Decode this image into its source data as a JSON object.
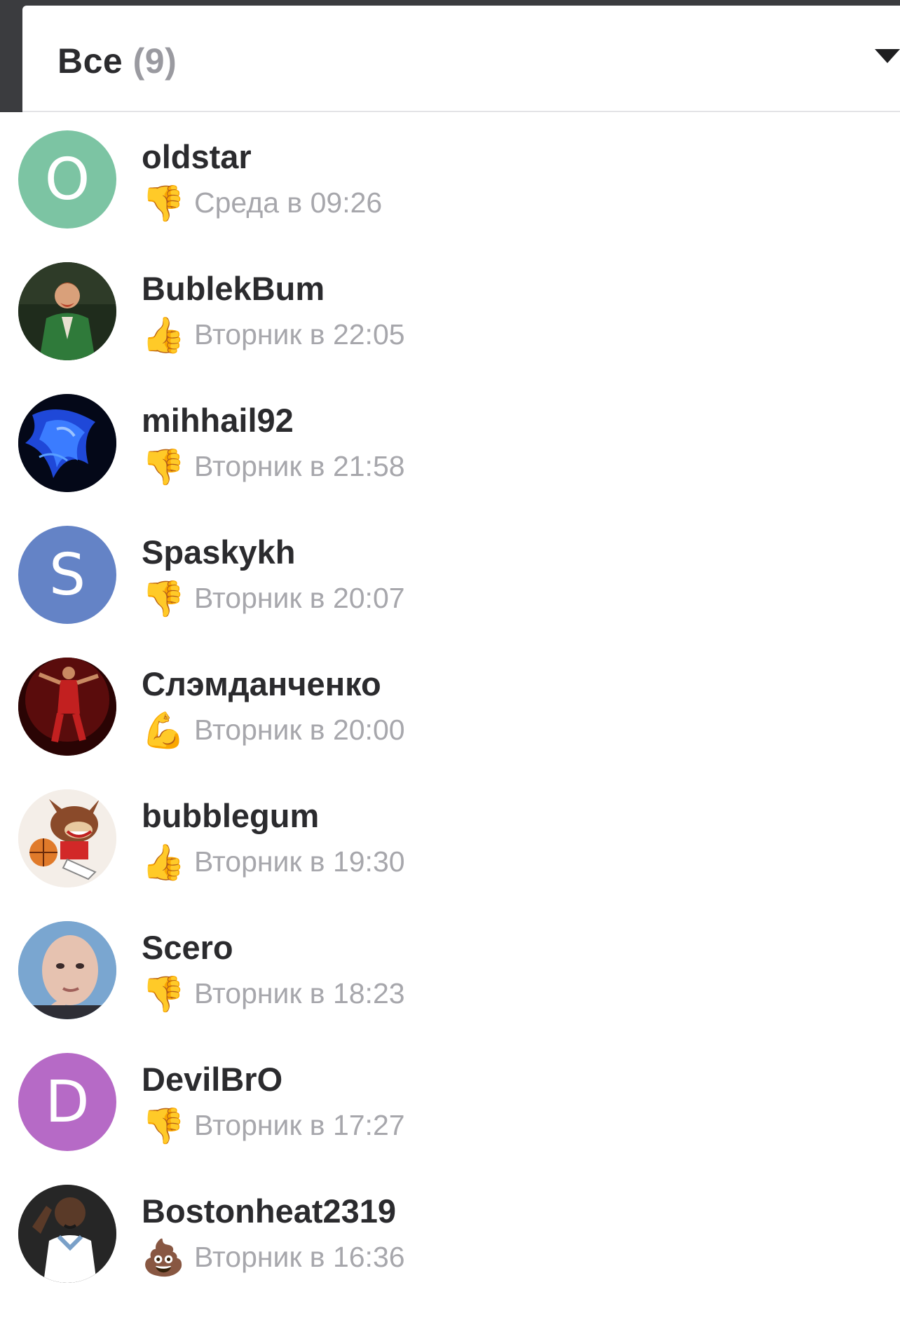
{
  "header": {
    "title": "Все",
    "count": "(9)"
  },
  "users": [
    {
      "name": "oldstar",
      "time": "Среда в 09:26",
      "reaction": "👎",
      "reaction_icon": "thumbs-down-icon",
      "avatar_letter": "O",
      "avatar_color": "#7cc4a3"
    },
    {
      "name": "BublekBum",
      "time": "Вторник в 22:05",
      "reaction": "👍",
      "reaction_icon": "thumbs-up-icon",
      "avatar_letter": "",
      "avatar_color": "#2f4a2a"
    },
    {
      "name": "mihhail92",
      "time": "Вторник в 21:58",
      "reaction": "👎",
      "reaction_icon": "thumbs-down-icon",
      "avatar_letter": "",
      "avatar_color": "#0a1a5a"
    },
    {
      "name": "Spaskykh",
      "time": "Вторник в 20:07",
      "reaction": "👎",
      "reaction_icon": "thumbs-down-icon",
      "avatar_letter": "S",
      "avatar_color": "#6483c6"
    },
    {
      "name": "Слэмданченко",
      "time": "Вторник в 20:00",
      "reaction": "💪",
      "reaction_icon": "flexed-biceps-icon",
      "avatar_letter": "",
      "avatar_color": "#4a0a0a"
    },
    {
      "name": "bubblegum",
      "time": "Вторник в 19:30",
      "reaction": "👍",
      "reaction_icon": "thumbs-up-icon",
      "avatar_letter": "",
      "avatar_color": "#f2ece6"
    },
    {
      "name": "Scero",
      "time": "Вторник в 18:23",
      "reaction": "👎",
      "reaction_icon": "thumbs-down-icon",
      "avatar_letter": "",
      "avatar_color": "#6f9cc8"
    },
    {
      "name": "DevilBrO",
      "time": "Вторник в 17:27",
      "reaction": "👎",
      "reaction_icon": "thumbs-down-icon",
      "avatar_letter": "D",
      "avatar_color": "#b66ac6"
    },
    {
      "name": "Bostonheat2319",
      "time": "Вторник в 16:36",
      "reaction": "💩",
      "reaction_icon": "pile-of-poo-icon",
      "avatar_letter": "",
      "avatar_color": "#3a3a3a"
    }
  ]
}
